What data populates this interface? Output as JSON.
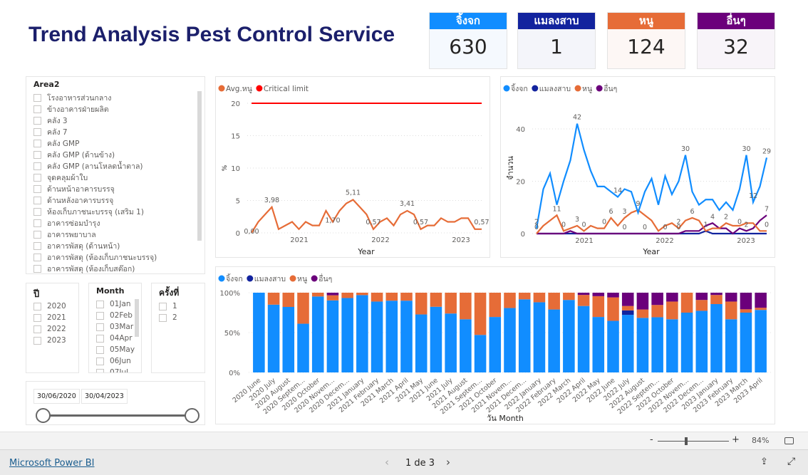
{
  "title": "Trend Analysis Pest Control Service",
  "colors": {
    "gecko": "#118DFF",
    "cockroach": "#12239E",
    "rat": "#E66C37",
    "other": "#6B007B",
    "critical": "#FF0000",
    "title": "#1b1f6b"
  },
  "kpis": [
    {
      "label": "จิ้งจก",
      "value": "630",
      "color": "#118DFF",
      "bg": "#f5f9fe"
    },
    {
      "label": "แมลงสาบ",
      "value": "1",
      "color": "#12239E",
      "bg": "#f4f5fa"
    },
    {
      "label": "หนู",
      "value": "124",
      "color": "#E66C37",
      "bg": "#fdf7f5"
    },
    {
      "label": "อื่นๆ",
      "value": "32",
      "color": "#6B007B",
      "bg": "#f8f4f9"
    }
  ],
  "area_slicer": {
    "title": "Area2",
    "items": [
      "โรงอาหารส่วนกลาง",
      "ข้างอาคารฝ่ายผลิต",
      "คลัง 3",
      "คลัง 7",
      "คลัง GMP",
      "คลัง GMP (ด้านข้าง)",
      "คลัง GMP (ลานโหลดน้ำตาล)",
      "จุดคลุมผ้าใบ",
      "ด้านหน้าอาคารบรรจุ",
      "ด้านหลังอาคารบรรจุ",
      "ห้องเก็บภาชนะบรรจุ (เสริม 1)",
      "อาคารซ่อมบำรุง",
      "อาคารพยาบาล",
      "อาคารพัสดุ (ด้านหน้า)",
      "อาคารพัสดุ (ห้องเก็บภาชนะบรรจุ)",
      "อาคารพัสดุ (ห้องเก็บสต๊อก)"
    ]
  },
  "year_slicer": {
    "title": "ปี",
    "items": [
      "2020",
      "2021",
      "2022",
      "2023"
    ]
  },
  "month_slicer": {
    "title": "Month",
    "items": [
      "01Jan",
      "02Feb",
      "03Mar",
      "04Apr",
      "05May",
      "06Jun",
      "07Jul"
    ]
  },
  "round_slicer": {
    "title": "ครั้งที่",
    "items": [
      "1",
      "2"
    ]
  },
  "date_slider": {
    "start": "30/06/2020",
    "end": "30/04/2023"
  },
  "chart_data": [
    {
      "type": "line",
      "xlabel": "Year",
      "ylabel": "%",
      "ylim": [
        0,
        20
      ],
      "yticks": [
        "0",
        "5",
        "10",
        "15",
        "20"
      ],
      "xticks": [
        "2021",
        "2022",
        "2023"
      ],
      "grid": true,
      "legend": "top-left",
      "series": [
        {
          "name": "Avg.หนู",
          "color": "#E66C37",
          "values": [
            0,
            1.7,
            2.84,
            3.98,
            0.57,
            1.14,
            1.7,
            0.57,
            1.7,
            1.14,
            1.14,
            3.41,
            1.7,
            3.41,
            4.55,
            5.11,
            3.98,
            2.84,
            0.57,
            1.7,
            2.27,
            1.14,
            2.84,
            3.41,
            2.84,
            0.57,
            1.14,
            1.14,
            2.27,
            1.7,
            1.7,
            2.27,
            2.27,
            0.57,
            0.57
          ]
        },
        {
          "name": "Critical limit",
          "color": "#FF0000",
          "value": 20
        }
      ],
      "labels": [
        {
          "i": 0,
          "t": "0,00",
          "pos": "below"
        },
        {
          "i": 3,
          "t": "3,98"
        },
        {
          "i": 12,
          "t": "1,70",
          "pos": "below"
        },
        {
          "i": 15,
          "t": "5,11"
        },
        {
          "i": 18,
          "t": "0,57"
        },
        {
          "i": 23,
          "t": "3,41"
        },
        {
          "i": 25,
          "t": "0,57"
        },
        {
          "i": 34,
          "t": "0,57"
        }
      ]
    },
    {
      "type": "line",
      "xlabel": "Year",
      "ylabel": "จำนวน",
      "ylim": [
        0,
        45
      ],
      "yticks": [
        "0",
        "20",
        "40"
      ],
      "xticks": [
        "2021",
        "2022",
        "2023"
      ],
      "grid": true,
      "legend": "top-left",
      "series": [
        {
          "name": "จิ้งจก",
          "color": "#118DFF",
          "values": [
            2,
            17,
            23,
            11,
            20,
            28,
            42,
            32,
            24,
            18,
            18,
            16,
            14,
            17,
            16,
            8,
            16,
            21,
            11,
            22,
            15,
            20,
            30,
            16,
            11,
            13,
            13,
            9,
            12,
            9,
            17,
            30,
            12,
            18,
            29
          ]
        },
        {
          "name": "แมลงสาบ",
          "color": "#12239E",
          "values": [
            0,
            0,
            0,
            0,
            0,
            0,
            0,
            0,
            0,
            0,
            0,
            0,
            0,
            0,
            0,
            0,
            0,
            0,
            0,
            0,
            0,
            0,
            0,
            0,
            0,
            1,
            0,
            0,
            0,
            0,
            0,
            0,
            0,
            0,
            0
          ]
        },
        {
          "name": "หนู",
          "color": "#E66C37",
          "values": [
            0,
            3,
            5,
            7,
            1,
            2,
            3,
            1,
            3,
            2,
            2,
            6,
            3,
            6,
            8,
            9,
            7,
            5,
            1,
            3,
            4,
            2,
            5,
            6,
            5,
            1,
            2,
            2,
            4,
            3,
            3,
            4,
            4,
            1,
            1
          ]
        },
        {
          "name": "อื่นๆ",
          "color": "#6B007B",
          "values": [
            0,
            0,
            0,
            0,
            0,
            1,
            0,
            0,
            0,
            0,
            0,
            0,
            0,
            0,
            0,
            0,
            0,
            0,
            0,
            0,
            0,
            0,
            1,
            1,
            1,
            3,
            4,
            2,
            2,
            0,
            2,
            1,
            2,
            5,
            7
          ]
        }
      ],
      "labels": [
        {
          "s": 0,
          "i": 0,
          "t": "2"
        },
        {
          "s": 2,
          "i": 0,
          "t": "0"
        },
        {
          "s": 2,
          "i": 3,
          "t": "11"
        },
        {
          "s": 0,
          "i": 6,
          "t": "42"
        },
        {
          "s": 2,
          "i": 4,
          "t": "0"
        },
        {
          "s": 2,
          "i": 6,
          "t": "3"
        },
        {
          "s": 2,
          "i": 7,
          "t": "0"
        },
        {
          "s": 2,
          "i": 11,
          "t": "6"
        },
        {
          "s": 2,
          "i": 10,
          "t": "0"
        },
        {
          "s": 2,
          "i": 13,
          "t": "3"
        },
        {
          "s": 0,
          "i": 12,
          "t": "14"
        },
        {
          "s": 2,
          "i": 15,
          "t": "9"
        },
        {
          "s": 3,
          "i": 13,
          "t": "0"
        },
        {
          "s": 3,
          "i": 16,
          "t": "0"
        },
        {
          "s": 3,
          "i": 19,
          "t": "0"
        },
        {
          "s": 2,
          "i": 21,
          "t": "2"
        },
        {
          "s": 3,
          "i": 21,
          "t": "0"
        },
        {
          "s": 0,
          "i": 22,
          "t": "30"
        },
        {
          "s": 2,
          "i": 23,
          "t": "6"
        },
        {
          "s": 1,
          "i": 25,
          "t": "1"
        },
        {
          "s": 3,
          "i": 26,
          "t": "4"
        },
        {
          "s": 2,
          "i": 28,
          "t": "2"
        },
        {
          "s": 3,
          "i": 30,
          "t": "0"
        },
        {
          "s": 3,
          "i": 31,
          "t": "2"
        },
        {
          "s": 0,
          "i": 31,
          "t": "30"
        },
        {
          "s": 0,
          "i": 32,
          "t": "12"
        },
        {
          "s": 3,
          "i": 34,
          "t": "7"
        },
        {
          "s": 0,
          "i": 34,
          "t": "29"
        },
        {
          "s": 2,
          "i": 34,
          "t": "0"
        }
      ]
    },
    {
      "type": "bar",
      "stacked": "100%",
      "xlabel": "วัน Month",
      "ylim": [
        0,
        100
      ],
      "yticks": [
        "0%",
        "50%",
        "100%"
      ],
      "legend": "top-left",
      "categories": [
        "2020 June",
        "2020 July",
        "2020 August",
        "2020 Septem...",
        "2020 October",
        "2020 Novem...",
        "2020 Decem...",
        "2021 January",
        "2021 February",
        "2021 March",
        "2021 April",
        "2021 May",
        "2021 June",
        "2021 July",
        "2021 August",
        "2021 Septem...",
        "2021 October",
        "2021 Novem...",
        "2021 Decem...",
        "2022 January",
        "2022 February",
        "2022 March",
        "2022 April",
        "2022 May",
        "2022 June",
        "2022 July",
        "2022 August",
        "2022 Septem...",
        "2022 October",
        "2022 Novem...",
        "2022 Decem...",
        "2023 January",
        "2023 February",
        "2023 March",
        "2023 April"
      ],
      "series_from": "chart_data.1.series"
    }
  ],
  "zoom": {
    "minus": "-",
    "plus": "+",
    "level": "84%"
  },
  "footer": {
    "brand": "Microsoft Power BI",
    "page": "1 de 3"
  }
}
